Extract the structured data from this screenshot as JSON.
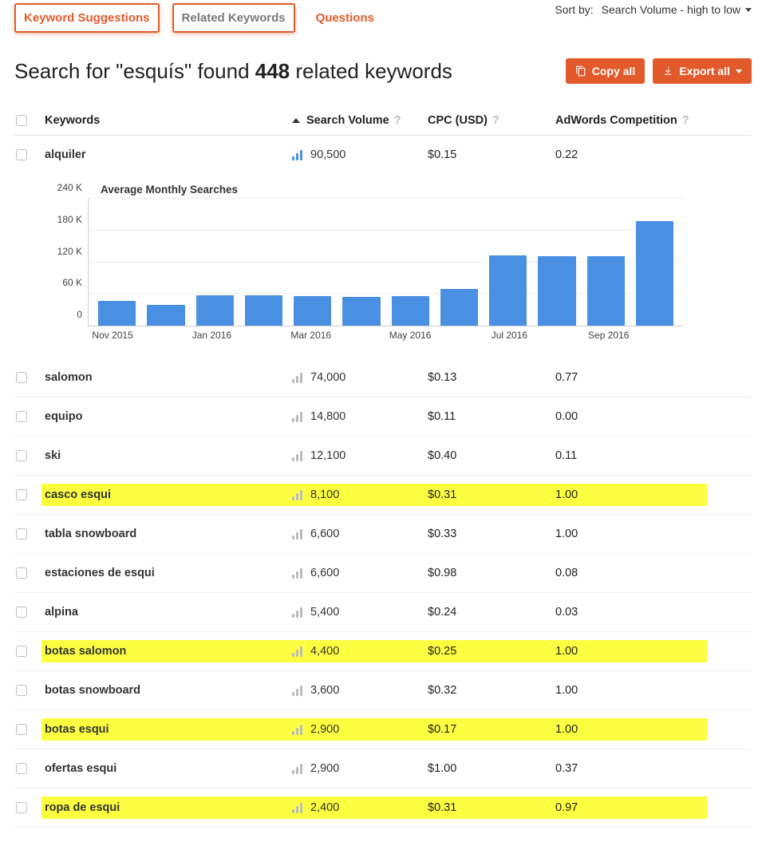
{
  "tabs": {
    "suggestions": "Keyword Suggestions",
    "related": "Related Keywords",
    "questions": "Questions"
  },
  "sort": {
    "label": "Sort by:",
    "value": "Search Volume - high to low"
  },
  "heading": {
    "prefix": "Search for \"",
    "term": "esquís",
    "mid": "\" found ",
    "count": "448",
    "suffix": " related keywords"
  },
  "buttons": {
    "copy": "Copy all",
    "export": "Export all"
  },
  "columns": {
    "keywords": "Keywords",
    "volume": "Search Volume",
    "cpc": "CPC (USD)",
    "adwords": "AdWords Competition"
  },
  "chart": {
    "title": "Average Monthly Searches"
  },
  "chart_data": {
    "type": "bar",
    "title": "Average Monthly Searches",
    "ylabel": "",
    "xlabel": "",
    "ylim": [
      0,
      240000
    ],
    "y_ticks": [
      "0",
      "60 K",
      "120 K",
      "180 K",
      "240 K"
    ],
    "x_ticks": [
      {
        "label": "Nov 2015",
        "pos": 4.17
      },
      {
        "label": "Jan 2016",
        "pos": 20.83
      },
      {
        "label": "Mar 2016",
        "pos": 37.5
      },
      {
        "label": "May 2016",
        "pos": 54.17
      },
      {
        "label": "Jul 2016",
        "pos": 70.83
      },
      {
        "label": "Sep 2016",
        "pos": 87.5
      }
    ],
    "categories": [
      "Nov 2015",
      "Dec 2015",
      "Jan 2016",
      "Feb 2016",
      "Mar 2016",
      "Apr 2016",
      "May 2016",
      "Jun 2016",
      "Jul 2016",
      "Aug 2016",
      "Sep 2016",
      "Oct 2016"
    ],
    "values": [
      47000,
      40000,
      58000,
      57000,
      56000,
      55000,
      56000,
      70000,
      133000,
      132000,
      132000,
      198000
    ]
  },
  "rows": [
    {
      "keyword": "alquiler",
      "volume": "90,500",
      "cpc": "$0.15",
      "adw": "0.22",
      "highlight": false,
      "active": true
    },
    {
      "keyword": "salomon",
      "volume": "74,000",
      "cpc": "$0.13",
      "adw": "0.77",
      "highlight": false,
      "active": false
    },
    {
      "keyword": "equipo",
      "volume": "14,800",
      "cpc": "$0.11",
      "adw": "0.00",
      "highlight": false,
      "active": false
    },
    {
      "keyword": "ski",
      "volume": "12,100",
      "cpc": "$0.40",
      "adw": "0.11",
      "highlight": false,
      "active": false
    },
    {
      "keyword": "casco esqui",
      "volume": "8,100",
      "cpc": "$0.31",
      "adw": "1.00",
      "highlight": true,
      "active": false
    },
    {
      "keyword": "tabla snowboard",
      "volume": "6,600",
      "cpc": "$0.33",
      "adw": "1.00",
      "highlight": false,
      "active": false
    },
    {
      "keyword": "estaciones de esqui",
      "volume": "6,600",
      "cpc": "$0.98",
      "adw": "0.08",
      "highlight": false,
      "active": false
    },
    {
      "keyword": "alpina",
      "volume": "5,400",
      "cpc": "$0.24",
      "adw": "0.03",
      "highlight": false,
      "active": false
    },
    {
      "keyword": "botas salomon",
      "volume": "4,400",
      "cpc": "$0.25",
      "adw": "1.00",
      "highlight": true,
      "active": false
    },
    {
      "keyword": "botas snowboard",
      "volume": "3,600",
      "cpc": "$0.32",
      "adw": "1.00",
      "highlight": false,
      "active": false
    },
    {
      "keyword": "botas esqui",
      "volume": "2,900",
      "cpc": "$0.17",
      "adw": "1.00",
      "highlight": true,
      "active": false
    },
    {
      "keyword": "ofertas esqui",
      "volume": "2,900",
      "cpc": "$1.00",
      "adw": "0.37",
      "highlight": false,
      "active": false
    },
    {
      "keyword": "ropa de esqui",
      "volume": "2,400",
      "cpc": "$0.31",
      "adw": "0.97",
      "highlight": true,
      "active": false
    }
  ]
}
